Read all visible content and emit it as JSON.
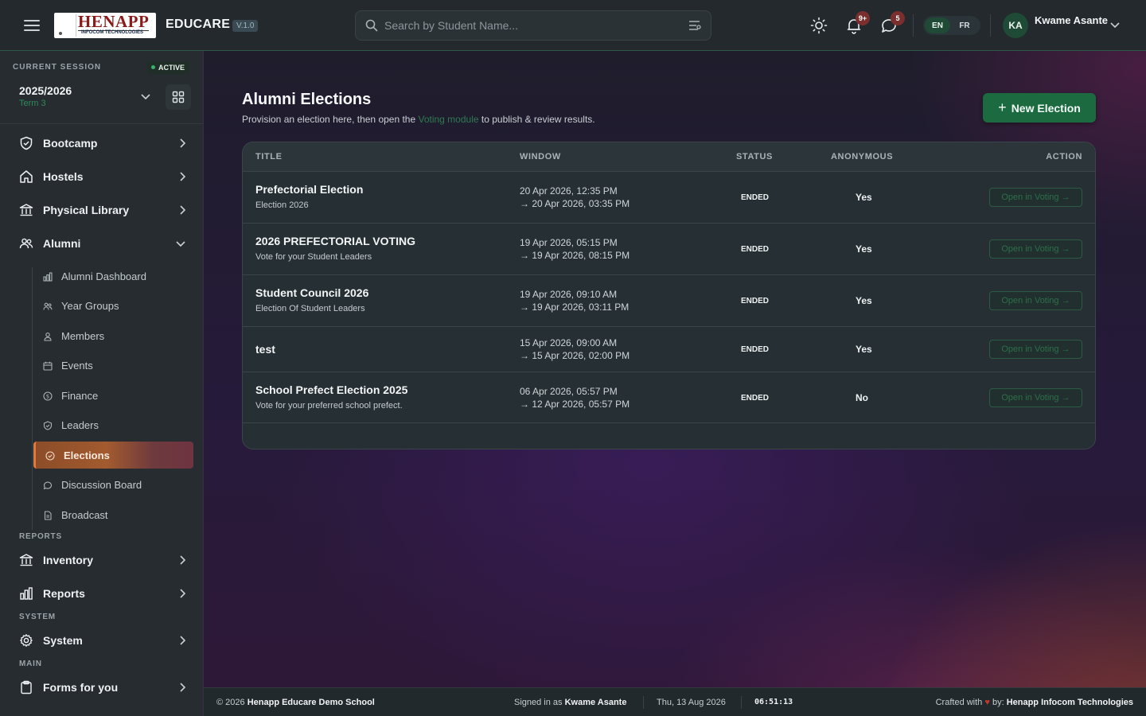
{
  "topbar": {
    "logo_main": "HENAPP",
    "logo_sub": "INFOCOM TECHNOLOGIES",
    "app_name": "EDUCARE",
    "version": "V.1.0",
    "search_placeholder": "Search by Student Name...",
    "notifications_badge": "9+",
    "messages_badge": "5",
    "lang_en": "EN",
    "lang_fr": "FR",
    "avatar_initials": "KA",
    "user_name": "Kwame Asante"
  },
  "sidebar": {
    "session_label": "CURRENT SESSION",
    "session_status": "ACTIVE",
    "session_year": "2025/2026",
    "session_term": "Term 3",
    "nav": {
      "bootcamp": "Bootcamp",
      "hostels": "Hostels",
      "physical_library": "Physical Library",
      "alumni": "Alumni",
      "inventory": "Inventory",
      "reports": "Reports",
      "system": "System",
      "forms": "Forms for you"
    },
    "alumni_items": {
      "dashboard": "Alumni Dashboard",
      "year_groups": "Year Groups",
      "members": "Members",
      "events": "Events",
      "finance": "Finance",
      "leaders": "Leaders",
      "elections": "Elections",
      "discussion": "Discussion Board",
      "broadcast": "Broadcast"
    },
    "sections": {
      "reports": "REPORTS",
      "system": "SYSTEM",
      "main": "MAIN"
    }
  },
  "main": {
    "title": "Alumni Elections",
    "subtitle_before": "Provision an election here, then open the ",
    "subtitle_link": "Voting module",
    "subtitle_after": " to publish & review results.",
    "new_button": "New Election",
    "columns": {
      "title": "TITLE",
      "window": "WINDOW",
      "status": "STATUS",
      "anonymous": "ANONYMOUS",
      "action": "ACTION"
    },
    "rows": [
      {
        "title": "Prefectorial Election",
        "desc": "Election 2026",
        "start": "20 Apr 2026, 12:35 PM",
        "end": "→ 20 Apr 2026, 03:35 PM",
        "status": "ENDED",
        "anonymous": "Yes",
        "action": "Open in Voting →"
      },
      {
        "title": "2026 PREFECTORIAL VOTING",
        "desc": "Vote for your Student Leaders",
        "start": "19 Apr 2026, 05:15 PM",
        "end": "→ 19 Apr 2026, 08:15 PM",
        "status": "ENDED",
        "anonymous": "Yes",
        "action": "Open in Voting →"
      },
      {
        "title": "Student Council 2026",
        "desc": "Election Of Student Leaders",
        "start": "19 Apr 2026, 09:10 AM",
        "end": "→ 19 Apr 2026, 03:11 PM",
        "status": "ENDED",
        "anonymous": "Yes",
        "action": "Open in Voting →"
      },
      {
        "title": "test",
        "desc": "",
        "start": "15 Apr 2026, 09:00 AM",
        "end": "→ 15 Apr 2026, 02:00 PM",
        "status": "ENDED",
        "anonymous": "Yes",
        "action": "Open in Voting →"
      },
      {
        "title": "School Prefect Election 2025",
        "desc": "Vote for your preferred school prefect.",
        "start": "06 Apr 2026, 05:57 PM",
        "end": "→ 12 Apr 2026, 05:57 PM",
        "status": "ENDED",
        "anonymous": "No",
        "action": "Open in Voting →"
      }
    ]
  },
  "footer": {
    "copyright_prefix": "© 2026 ",
    "school": "Henapp Educare Demo School",
    "signed_prefix": "Signed in as ",
    "signed_user": "Kwame Asante",
    "date": "Thu, 13 Aug 2026",
    "time": "06:51:13",
    "crafted_prefix": "Crafted with ",
    "heart": "♥",
    "crafted_by": " by: ",
    "company": "Henapp Infocom Technologies"
  },
  "colors": {
    "accent_green": "#1c6a40",
    "active_orange": "#a35a2f",
    "link_green": "#2e7a4f"
  },
  "icons": [
    "hamburger-icon",
    "search-icon",
    "filter-icon",
    "sun-icon",
    "bell-icon",
    "chat-icon",
    "chevron-down-icon",
    "grid-icon",
    "shield-icon",
    "home-icon",
    "library-icon",
    "users-icon",
    "chart-icon",
    "user-icon",
    "calendar-icon",
    "coin-icon",
    "badge-icon",
    "vote-icon",
    "message-icon",
    "document-icon",
    "building-icon",
    "gear-icon",
    "clipboard-icon",
    "chevron-right-icon",
    "plus-icon"
  ]
}
